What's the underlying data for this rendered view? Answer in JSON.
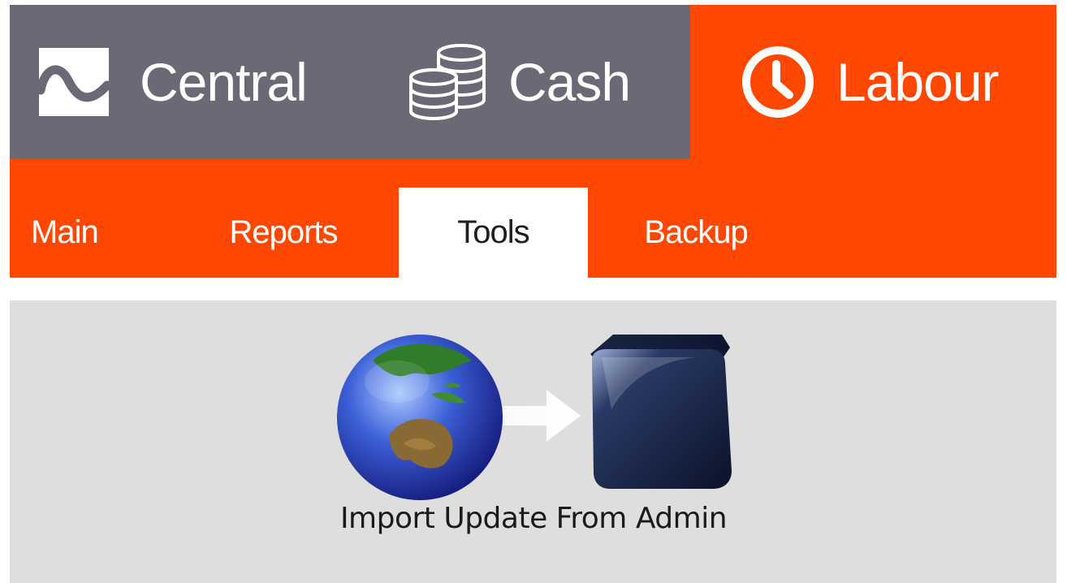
{
  "apps": [
    {
      "label": "Central",
      "icon": "central-logo-icon",
      "active": false
    },
    {
      "label": "Cash",
      "icon": "coins-icon",
      "active": false
    },
    {
      "label": "Labour",
      "icon": "clock-icon",
      "active": true
    }
  ],
  "subtabs": [
    {
      "label": "Main",
      "active": false
    },
    {
      "label": "Reports",
      "active": false
    },
    {
      "label": "Tools",
      "active": true
    },
    {
      "label": "Backup",
      "active": false
    }
  ],
  "tools": {
    "import_update": {
      "label": "Import Update From Admin",
      "icon": "globe-to-server-icon"
    }
  },
  "colors": {
    "app_bar": "#6a6a76",
    "accent": "#fe4701",
    "content_bg": "#dedede"
  }
}
